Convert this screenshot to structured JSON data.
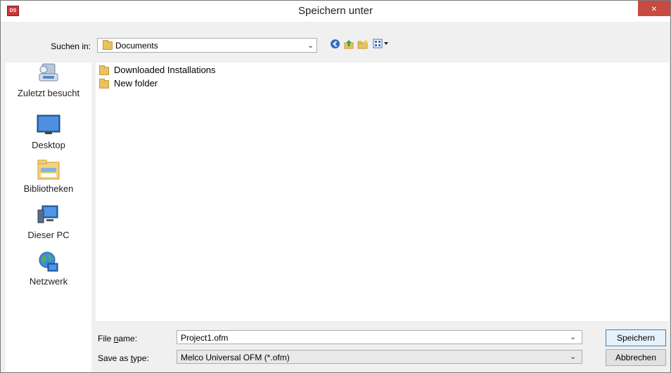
{
  "window": {
    "title": "Speichern unter",
    "app_icon_text": "DS",
    "close_glyph": "×"
  },
  "toolbar": {
    "look_in_label": "Suchen in:",
    "look_in_value": "Documents",
    "back_icon": "back-icon",
    "up_icon": "up-folder-icon",
    "new_folder_icon": "new-folder-icon",
    "view_icon": "view-menu-icon"
  },
  "places": [
    {
      "label": "Zuletzt besucht",
      "icon": "recent-places-icon"
    },
    {
      "label": "Desktop",
      "icon": "desktop-icon"
    },
    {
      "label": "Bibliotheken",
      "icon": "libraries-icon"
    },
    {
      "label": "Dieser PC",
      "icon": "computer-icon"
    },
    {
      "label": "Netzwerk",
      "icon": "network-icon"
    }
  ],
  "files": [
    {
      "name": "Downloaded Installations",
      "icon": "folder-icon"
    },
    {
      "name": "New folder",
      "icon": "folder-icon"
    }
  ],
  "form": {
    "file_name_label_pre": "File ",
    "file_name_label_accel": "n",
    "file_name_label_post": "ame:",
    "file_name_value": "Project1.ofm",
    "save_type_label_pre": "Save as ",
    "save_type_label_accel": "t",
    "save_type_label_post": "ype:",
    "save_type_value": "Melco Universal OFM (*.ofm)"
  },
  "buttons": {
    "save": "Speichern",
    "cancel": "Abbrechen"
  },
  "colors": {
    "close_button": "#c74a43",
    "folder": "#e8c160",
    "dialog_bg": "#f0f0f0"
  }
}
